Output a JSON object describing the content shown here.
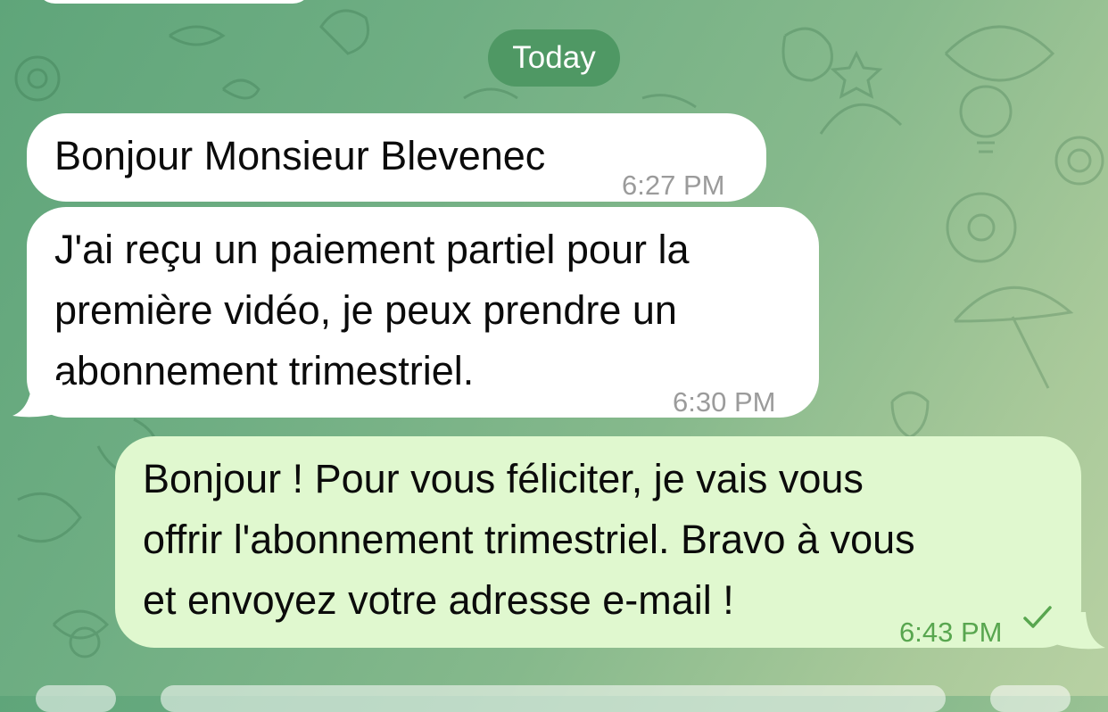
{
  "chat": {
    "date_separator": "Today",
    "messages": [
      {
        "direction": "incoming",
        "text": "Bonjour Monsieur Blevenec",
        "time": "6:27 PM"
      },
      {
        "direction": "incoming",
        "lines": [
          "J'ai reçu un paiement partiel pour la",
          "première vidéo, je peux prendre un",
          "abonnement trimestriel."
        ],
        "time": "6:30 PM"
      },
      {
        "direction": "outgoing",
        "lines": [
          "Bonjour ! Pour vous féliciter, je vais vous",
          "offrir l'abonnement trimestriel. Bravo à  vous",
          "et envoyez votre adresse e-mail !"
        ],
        "time": "6:43 PM",
        "status_icon": "single-check-icon"
      }
    ]
  },
  "colors": {
    "incoming_bubble": "#ffffff",
    "outgoing_bubble": "#e0f8cf",
    "date_pill": "#4f9864",
    "outgoing_time": "#58a64f",
    "incoming_time": "#9b9b9b"
  }
}
